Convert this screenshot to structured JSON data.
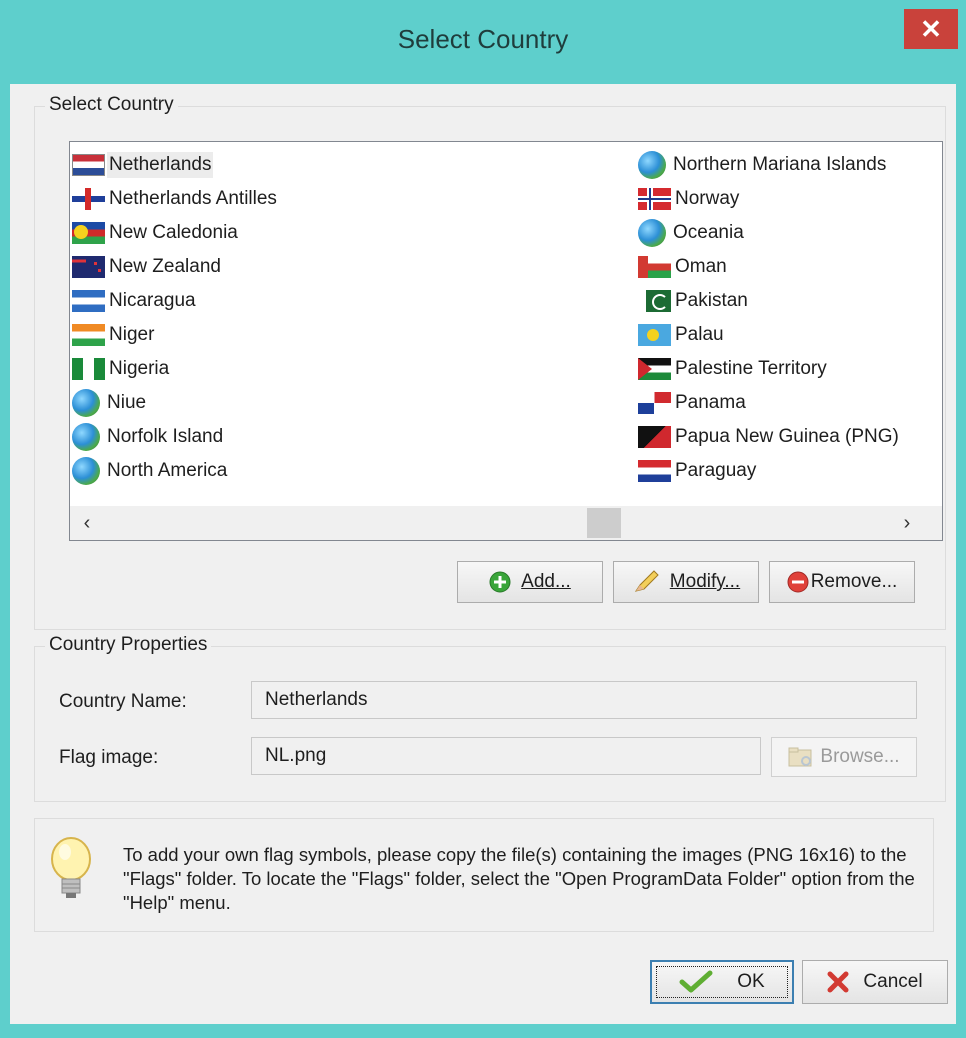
{
  "window": {
    "title": "Select Country",
    "close_glyph": "✕"
  },
  "country_group": {
    "caption": "Select Country",
    "left_column": [
      {
        "label": "Netherlands",
        "icon": "flag-netherlands-icon",
        "selected": true
      },
      {
        "label": "Netherlands Antilles",
        "icon": "flag-netherlands-antilles-icon"
      },
      {
        "label": "New Caledonia",
        "icon": "flag-new-caledonia-icon"
      },
      {
        "label": "New Zealand",
        "icon": "flag-new-zealand-icon"
      },
      {
        "label": "Nicaragua",
        "icon": "flag-nicaragua-icon"
      },
      {
        "label": "Niger",
        "icon": "flag-niger-icon"
      },
      {
        "label": "Nigeria",
        "icon": "flag-nigeria-icon"
      },
      {
        "label": "Niue",
        "icon": "globe-icon"
      },
      {
        "label": "Norfolk Island",
        "icon": "globe-icon"
      },
      {
        "label": "North America",
        "icon": "globe-icon"
      }
    ],
    "right_column": [
      {
        "label": "Northern Mariana Islands",
        "icon": "globe-icon"
      },
      {
        "label": "Norway",
        "icon": "flag-norway-icon"
      },
      {
        "label": "Oceania",
        "icon": "globe-icon"
      },
      {
        "label": "Oman",
        "icon": "flag-oman-icon"
      },
      {
        "label": "Pakistan",
        "icon": "flag-pakistan-icon"
      },
      {
        "label": "Palau",
        "icon": "flag-palau-icon"
      },
      {
        "label": "Palestine Territory",
        "icon": "flag-palestine-icon"
      },
      {
        "label": "Panama",
        "icon": "flag-panama-icon"
      },
      {
        "label": "Papua New Guinea (PNG)",
        "icon": "flag-papua-new-guinea-icon"
      },
      {
        "label": "Paraguay",
        "icon": "flag-paraguay-icon"
      }
    ],
    "scroll_left": "‹",
    "scroll_right": "›",
    "add_label": "Add...",
    "modify_label": "Modify...",
    "remove_label": "Remove..."
  },
  "properties": {
    "caption": "Country Properties",
    "name_label": "Country Name:",
    "name_value": "Netherlands",
    "flag_label": "Flag image:",
    "flag_value": "NL.png",
    "browse_label": "Browse..."
  },
  "tip": {
    "icon": "lightbulb-icon",
    "text": "To add your own flag symbols, please copy the file(s) containing the images (PNG 16x16) to the \"Flags\" folder. To locate the \"Flags\" folder, select the \"Open ProgramData Folder\" option from the \"Help\" menu."
  },
  "footer": {
    "ok_label": "OK",
    "cancel_label": "Cancel"
  },
  "colors": {
    "title_bar": "#5ecfcc",
    "close_button": "#c9423b",
    "dialog_bg": "#f0f0f0"
  }
}
